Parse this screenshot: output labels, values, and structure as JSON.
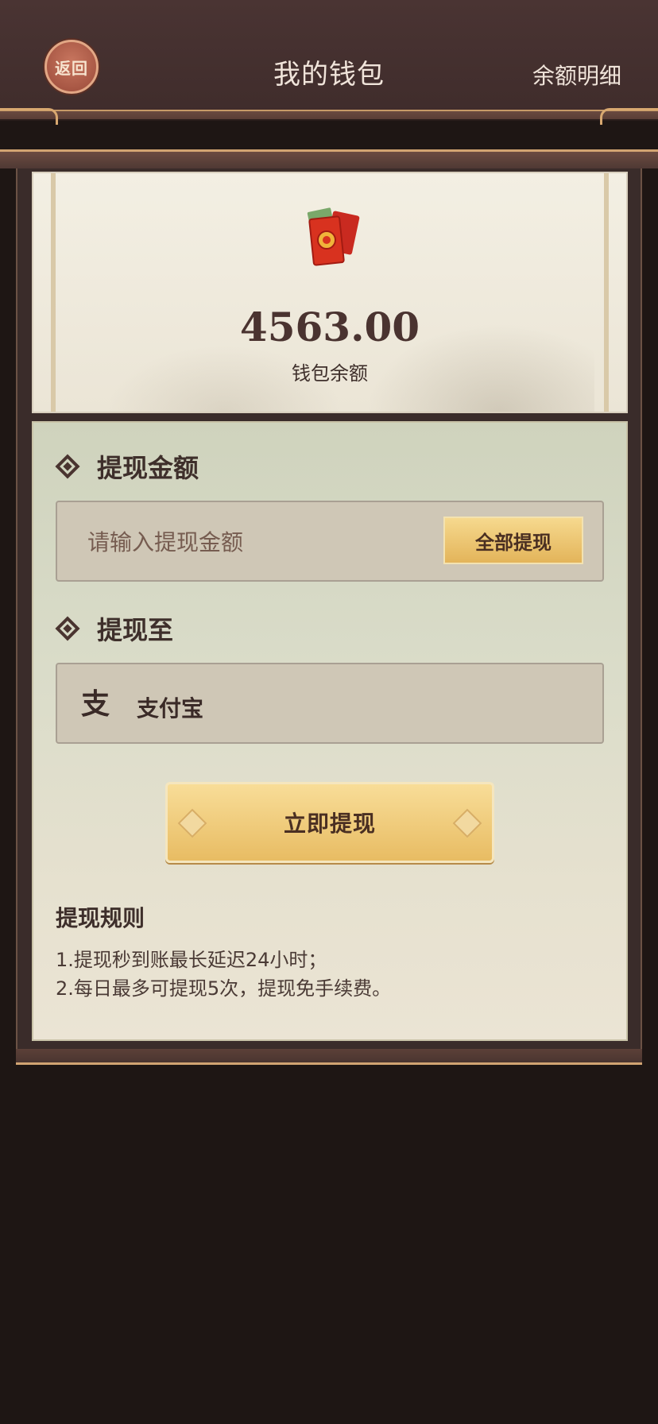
{
  "header": {
    "back_label": "返回",
    "title": "我的钱包",
    "detail_link": "余额明细"
  },
  "balance": {
    "value": "4563.00",
    "label": "钱包余额",
    "icon": "red-packet-icon"
  },
  "withdraw": {
    "amount_section_title": "提现金额",
    "amount_placeholder": "请输入提现金额",
    "amount_value": "",
    "all_button": "全部提现",
    "target_section_title": "提现至",
    "target_method": "支付宝",
    "target_icon": "alipay-icon",
    "submit_button": "立即提现"
  },
  "rules": {
    "title": "提现规则",
    "items": [
      "1.提现秒到账最长延迟24小时；",
      "2.每日最多可提现5次，提现免手续费。"
    ]
  },
  "colors": {
    "background": "#1e1614",
    "header": "#45302f",
    "gold_button": "#e8bc63",
    "text_dark": "#3e2f2b"
  }
}
